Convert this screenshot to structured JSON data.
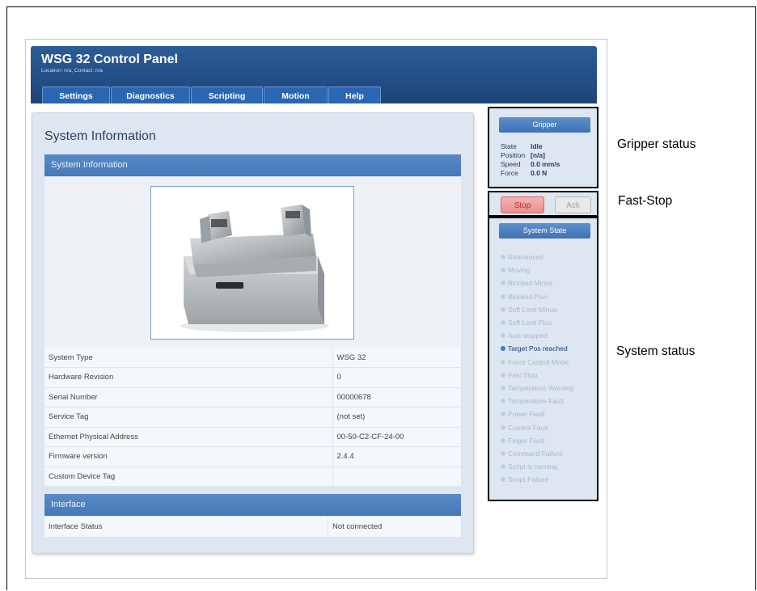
{
  "app": {
    "title": "WSG 32 Control Panel",
    "subtitle": "Location: n/a, Contact: n/a"
  },
  "tabs": [
    {
      "label": "Settings"
    },
    {
      "label": "Diagnostics"
    },
    {
      "label": "Scripting"
    },
    {
      "label": "Motion"
    },
    {
      "label": "Help"
    }
  ],
  "main": {
    "title": "System Information",
    "system_section_label": "System Information",
    "rows": [
      {
        "label": "System Type",
        "value": "WSG 32"
      },
      {
        "label": "Hardware Revision",
        "value": "0"
      },
      {
        "label": "Serial Number",
        "value": "00000678"
      },
      {
        "label": "Service Tag",
        "value": "(not set)"
      },
      {
        "label": "Ethernet Physical Address",
        "value": "00-50-C2-CF-24-00"
      },
      {
        "label": "Firmware version",
        "value": "2.4.4"
      },
      {
        "label": "Custom Device Tag",
        "value": ""
      }
    ],
    "interface_section_label": "Interface",
    "interface_rows": [
      {
        "label": "Interface Status",
        "value": "Not connected"
      }
    ]
  },
  "gripper": {
    "button_label": "Gripper",
    "state_label": "State",
    "state_value": "Idle",
    "position_label": "Position",
    "position_value": "[n/a]",
    "speed_label": "Speed",
    "speed_value": "0.0 mm/s",
    "force_label": "Force",
    "force_value": "0.0 N"
  },
  "faststop": {
    "stop_label": "Stop",
    "ack_label": "Ack"
  },
  "system_state": {
    "button_label": "System State",
    "items": [
      {
        "label": "Referenced",
        "active": false
      },
      {
        "label": "Moving",
        "active": false
      },
      {
        "label": "Blocked Minus",
        "active": false
      },
      {
        "label": "Blocked Plus",
        "active": false
      },
      {
        "label": "Soft Limit Minus",
        "active": false
      },
      {
        "label": "Soft Limit Plus",
        "active": false
      },
      {
        "label": "Axis stopped",
        "active": false
      },
      {
        "label": "Target Pos reached",
        "active": true
      },
      {
        "label": "Force Control Mode",
        "active": false
      },
      {
        "label": "Fast Stop",
        "active": false
      },
      {
        "label": "Temperature Warning",
        "active": false
      },
      {
        "label": "Temperature Fault",
        "active": false
      },
      {
        "label": "Power Fault",
        "active": false
      },
      {
        "label": "Current Fault",
        "active": false
      },
      {
        "label": "Finger Fault",
        "active": false
      },
      {
        "label": "Command Failure",
        "active": false
      },
      {
        "label": "Script is running",
        "active": false
      },
      {
        "label": "Script Failure",
        "active": false
      }
    ]
  },
  "annotations": {
    "gripper_status": "Gripper status",
    "fast_stop": "Fast-Stop",
    "system_status": "System status"
  },
  "colors": {
    "header_blue": "#1d4478",
    "tab_blue": "#2a67b3",
    "section_blue": "#4478b8",
    "panel_bg": "#dde6f1",
    "stop_red": "#e98f8f",
    "active_state": "#3d7cc9"
  }
}
